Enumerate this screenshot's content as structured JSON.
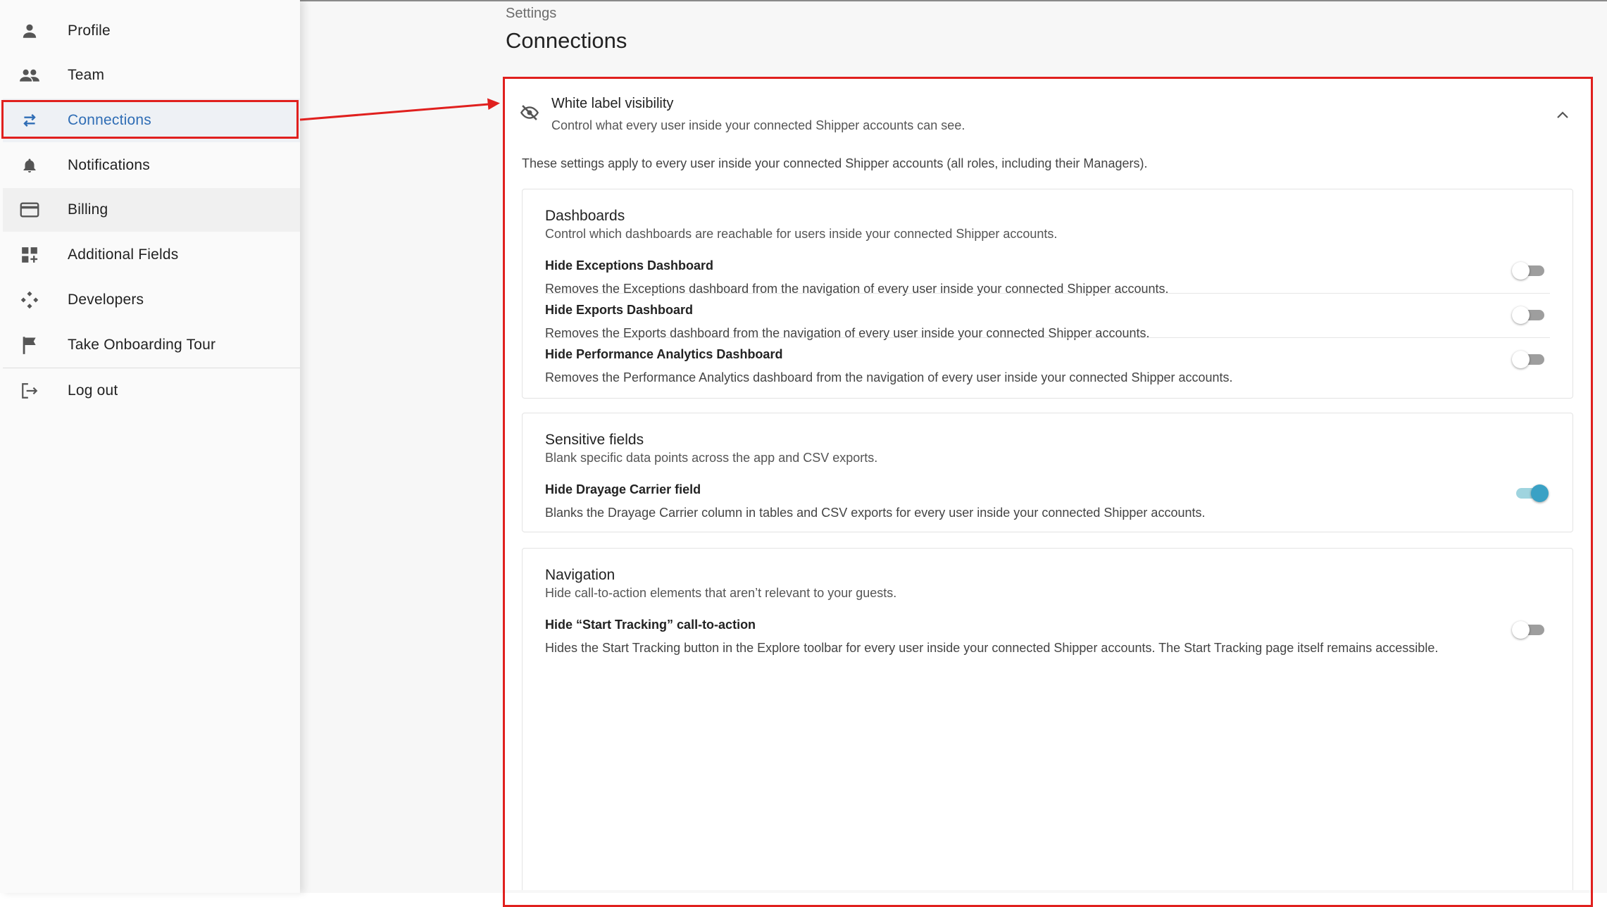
{
  "sidebar": {
    "items": [
      {
        "label": "Profile",
        "icon": "person-icon"
      },
      {
        "label": "Team",
        "icon": "people-icon"
      },
      {
        "label": "Connections",
        "icon": "swap-arrows-icon",
        "selected": true
      },
      {
        "label": "Notifications",
        "icon": "bell-icon"
      },
      {
        "label": "Billing",
        "icon": "credit-card-icon"
      },
      {
        "label": "Additional Fields",
        "icon": "add-grid-icon"
      },
      {
        "label": "Developers",
        "icon": "developer-diamond-icon"
      },
      {
        "label": "Take Onboarding Tour",
        "icon": "flag-icon"
      },
      {
        "label": "Log out",
        "icon": "logout-icon"
      }
    ]
  },
  "header": {
    "breadcrumb": "Settings",
    "title": "Connections"
  },
  "panel": {
    "title": "White label visibility",
    "subtitle": "Control what every user inside your connected Shipper accounts can see.",
    "icon": "eye-off-icon",
    "expanded": true,
    "note": "These settings apply to every user inside your connected Shipper accounts (all roles, including their Managers)."
  },
  "sections": {
    "dashboards": {
      "title": "Dashboards",
      "subtitle": "Control which dashboards are reachable for users inside your connected Shipper accounts.",
      "rows": [
        {
          "title": "Hide Exceptions Dashboard",
          "desc": "Removes the Exceptions dashboard from the navigation of every user inside your connected Shipper accounts.",
          "enabled": false
        },
        {
          "title": "Hide Exports Dashboard",
          "desc": "Removes the Exports dashboard from the navigation of every user inside your connected Shipper accounts.",
          "enabled": false
        },
        {
          "title": "Hide Performance Analytics Dashboard",
          "desc": "Removes the Performance Analytics dashboard from the navigation of every user inside your connected Shipper accounts.",
          "enabled": false
        }
      ]
    },
    "sensitive": {
      "title": "Sensitive fields",
      "subtitle": "Blank specific data points across the app and CSV exports.",
      "rows": [
        {
          "title": "Hide Drayage Carrier field",
          "desc": "Blanks the Drayage Carrier column in tables and CSV exports for every user inside your connected Shipper accounts.",
          "enabled": true
        }
      ]
    },
    "navigation": {
      "title": "Navigation",
      "subtitle": "Hide call-to-action elements that aren’t relevant to your guests.",
      "rows": [
        {
          "title": "Hide “Start Tracking” call-to-action",
          "desc": "Hides the Start Tracking button in the Explore toolbar for every user inside your connected Shipper accounts. The Start Tracking page itself remains accessible.",
          "enabled": false
        }
      ]
    }
  },
  "colors": {
    "accent": "#2f6db5",
    "annotation": "#e0201e",
    "toggle_on": "#3aa1c5"
  }
}
